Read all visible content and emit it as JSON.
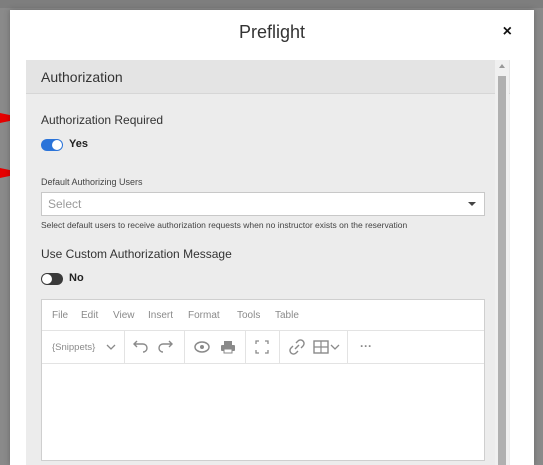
{
  "modal": {
    "title": "Preflight",
    "close_label": "×"
  },
  "section": {
    "title": "Authorization"
  },
  "authorization_required": {
    "label": "Authorization Required",
    "toggle_state": true,
    "toggle_text": "Yes"
  },
  "default_users": {
    "label": "Default Authorizing Users",
    "placeholder": "Select",
    "help_text": "Select default users to receive authorization requests when no instructor exists on the reservation"
  },
  "custom_message": {
    "label": "Use Custom Authorization Message",
    "toggle_state": false,
    "toggle_text": "No"
  },
  "editor": {
    "menu": [
      "File",
      "Edit",
      "View",
      "Insert",
      "Format",
      "Tools",
      "Table"
    ],
    "snippets_label": "{Snippets}",
    "more_label": "···"
  },
  "colors": {
    "accent": "#2b74d9",
    "annotation_arrow": "#e60000"
  }
}
